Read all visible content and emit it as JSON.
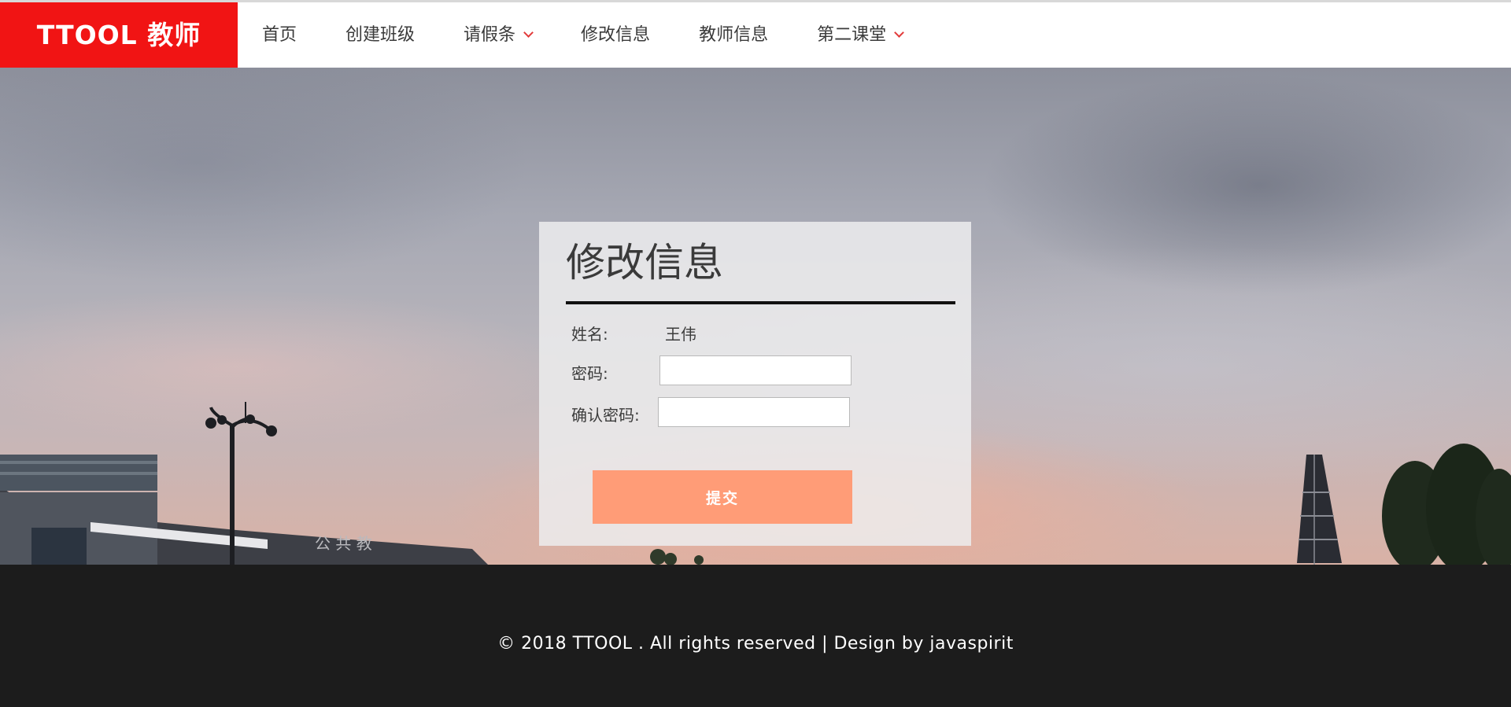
{
  "brand": {
    "name": "TTOOL 教师"
  },
  "nav": {
    "items": [
      {
        "label": "首页",
        "dropdown": false
      },
      {
        "label": "创建班级",
        "dropdown": false
      },
      {
        "label": "请假条",
        "dropdown": true
      },
      {
        "label": "修改信息",
        "dropdown": false
      },
      {
        "label": "教师信息",
        "dropdown": false
      },
      {
        "label": "第二课堂",
        "dropdown": true
      }
    ]
  },
  "hero": {
    "building_sign": "公 共 教"
  },
  "form": {
    "title": "修改信息",
    "name_label": "姓名:",
    "name_value": "王伟",
    "password_label": "密码:",
    "password_value": "",
    "confirm_label": "确认密码:",
    "confirm_value": "",
    "submit_label": "提交"
  },
  "footer": {
    "text": "© 2018 TTOOL . All rights reserved | Design by javaspirit"
  },
  "colors": {
    "brand_red": "#f11414",
    "submit_orange": "#ff9c77",
    "footer_bg": "#1c1c1c",
    "chevron": "#e23a3a"
  }
}
